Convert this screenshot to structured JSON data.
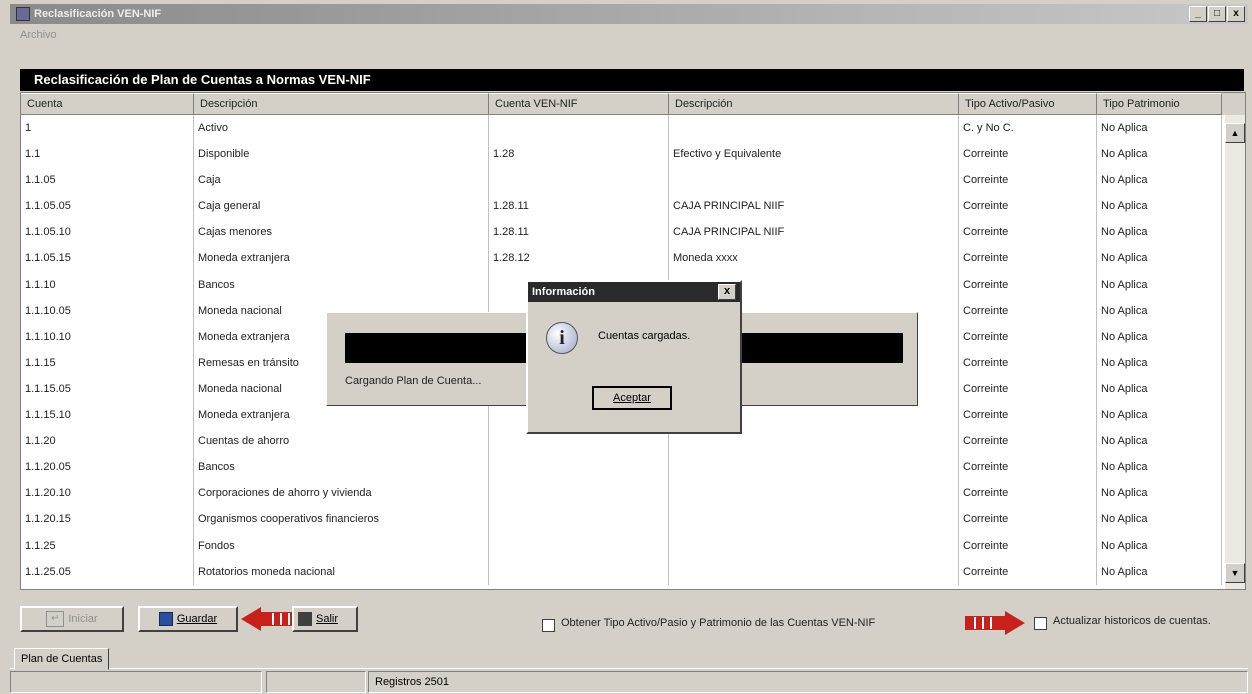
{
  "window": {
    "title": "Reclasificación VEN-NIF",
    "controls": {
      "minimize": "_",
      "maximize": "□",
      "close": "x"
    }
  },
  "menu": {
    "items": [
      {
        "label": "Archivo"
      }
    ]
  },
  "form": {
    "title": "Reclasificación de Plan de Cuentas a  Normas VEN-NIF"
  },
  "grid": {
    "columns": [
      "Cuenta",
      "Descripción",
      "Cuenta VEN-NIF",
      "Descripción",
      "Tipo Activo/Pasivo",
      "Tipo Patrimonio"
    ],
    "rows": [
      [
        "1",
        "Activo",
        "",
        "",
        "C. y No C.",
        "No Aplica"
      ],
      [
        "1.1",
        "Disponible",
        "1.28",
        "Efectivo y Equivalente",
        "Correinte",
        "No Aplica"
      ],
      [
        "1.1.05",
        "Caja",
        "",
        "",
        "Correinte",
        "No Aplica"
      ],
      [
        "1.1.05.05",
        "Caja general",
        "1.28.11",
        "CAJA PRINCIPAL NIIF",
        "Correinte",
        "No Aplica"
      ],
      [
        "1.1.05.10",
        "Cajas menores",
        "1.28.11",
        "CAJA PRINCIPAL NIIF",
        "Correinte",
        "No Aplica"
      ],
      [
        "1.1.05.15",
        "Moneda extranjera",
        "1.28.12",
        "Moneda xxxx",
        "Correinte",
        "No Aplica"
      ],
      [
        "1.1.10",
        "Bancos",
        "",
        "",
        "Correinte",
        "No Aplica"
      ],
      [
        "1.1.10.05",
        "Moneda nacional",
        "",
        "",
        "Correinte",
        "No Aplica"
      ],
      [
        "1.1.10.10",
        "Moneda extranjera",
        "",
        "",
        "Correinte",
        "No Aplica"
      ],
      [
        "1.1.15",
        "Remesas en tránsito",
        "",
        "",
        "Correinte",
        "No Aplica"
      ],
      [
        "1.1.15.05",
        "Moneda nacional",
        "",
        "",
        "Correinte",
        "No Aplica"
      ],
      [
        "1.1.15.10",
        "Moneda extranjera",
        "",
        "",
        "Correinte",
        "No Aplica"
      ],
      [
        "1.1.20",
        "Cuentas de ahorro",
        "",
        "",
        "Correinte",
        "No Aplica"
      ],
      [
        "1.1.20.05",
        "Bancos",
        "",
        "",
        "Correinte",
        "No Aplica"
      ],
      [
        "1.1.20.10",
        "Corporaciones de ahorro y vivienda",
        "",
        "",
        "Correinte",
        "No Aplica"
      ],
      [
        "1.1.20.15",
        "Organismos cooperativos financieros",
        "",
        "",
        "Correinte",
        "No Aplica"
      ],
      [
        "1.1.25",
        "Fondos",
        "",
        "",
        "Correinte",
        "No Aplica"
      ],
      [
        "1.1.25.05",
        "Rotatorios moneda nacional",
        "",
        "",
        "Correinte",
        "No Aplica"
      ]
    ],
    "scroll_up": "▲",
    "scroll_down": "▼"
  },
  "loading": {
    "text": "Cargando Plan de Cuenta..."
  },
  "dialog": {
    "title": "Información",
    "close": "x",
    "icon": "info-icon",
    "icon_glyph": "i",
    "message": "Cuentas cargadas.",
    "ok_label": "Aceptar"
  },
  "buttons": {
    "iniciar": "Iniciar",
    "guardar": "Guardar",
    "salir": "Salir"
  },
  "options": {
    "obtener_tipo": "Obtener Tipo Activo/Pasio y Patrimonio de las Cuentas VEN-NIF",
    "actualizar": "Actualizar historicos de cuentas."
  },
  "tabs": [
    {
      "label": "Plan de Cuentas"
    }
  ],
  "status": {
    "registros": "Registros 2501"
  },
  "colors": {
    "arrow": "#c8201a",
    "title_bg": "#000000"
  }
}
